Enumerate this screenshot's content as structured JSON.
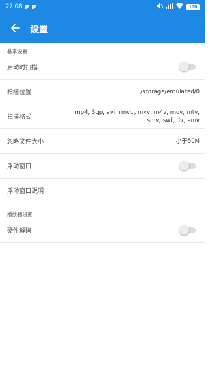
{
  "status": {
    "time": "22:08",
    "notif_icons": [
      "P",
      "P"
    ],
    "battery": "100"
  },
  "toolbar": {
    "title": "设置"
  },
  "sections": {
    "basic": {
      "header": "基本设置",
      "scan_on_start": "启动时扫描",
      "scan_location_label": "扫描位置",
      "scan_location_value": "/storage/emulated/0",
      "scan_format_label": "扫描格式",
      "scan_format_value": "mp4, 3gp, avi, rmvb, mkv, m4v, mov, mtv, smv, swf, dv, amv",
      "ignore_size_label": "忽略文件大小",
      "ignore_size_value": "小于50M",
      "float_window": "浮动窗口",
      "float_window_help": "浮动窗口说明"
    },
    "player": {
      "header": "播放器设置",
      "hw_decode": "硬件解码"
    }
  },
  "toggles": {
    "scan_on_start": false,
    "float_window": false,
    "hw_decode": false
  },
  "colors": {
    "primary": "#1e88e5"
  }
}
